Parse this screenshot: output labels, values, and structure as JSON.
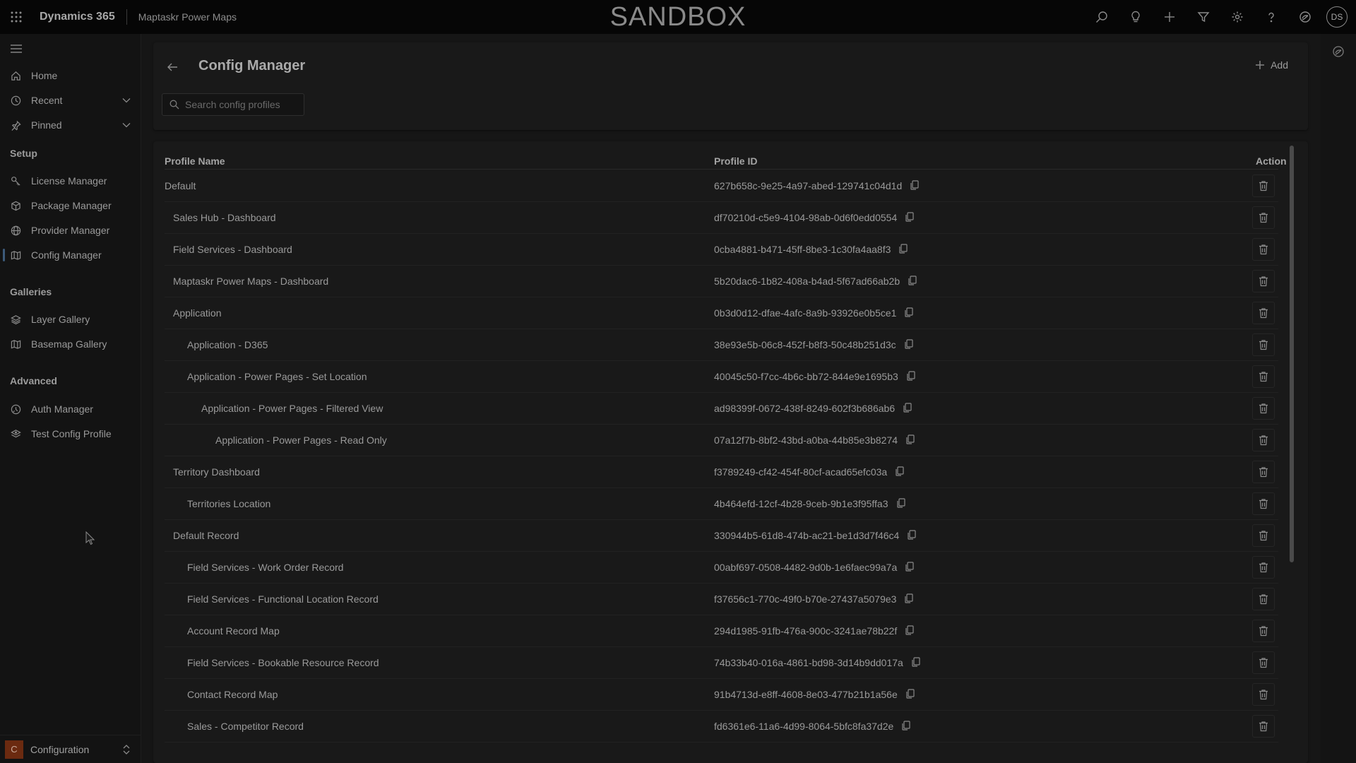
{
  "topbar": {
    "brand": "Dynamics 365",
    "app_name": "Maptaskr Power Maps",
    "environment_banner": "SANDBOX",
    "avatar_initials": "DS",
    "actions": [
      "search-icon",
      "lightbulb-icon",
      "plus-icon",
      "filter-icon",
      "gear-icon",
      "help-icon",
      "copilot-icon"
    ]
  },
  "sidebar": {
    "top_items": [
      {
        "label": "Home",
        "icon": "home-icon"
      },
      {
        "label": "Recent",
        "icon": "clock-icon",
        "expandable": true
      },
      {
        "label": "Pinned",
        "icon": "pin-icon",
        "expandable": true
      }
    ],
    "groups": [
      {
        "title": "Setup",
        "items": [
          {
            "label": "License Manager",
            "icon": "key-icon"
          },
          {
            "label": "Package Manager",
            "icon": "package-icon"
          },
          {
            "label": "Provider Manager",
            "icon": "globe-icon"
          },
          {
            "label": "Config Manager",
            "icon": "map-icon",
            "active": true
          }
        ]
      },
      {
        "title": "Galleries",
        "items": [
          {
            "label": "Layer Gallery",
            "icon": "layers-icon"
          },
          {
            "label": "Basemap Gallery",
            "icon": "map-icon"
          }
        ]
      },
      {
        "title": "Advanced",
        "items": [
          {
            "label": "Auth Manager",
            "icon": "auth-icon"
          },
          {
            "label": "Test Config Profile",
            "icon": "test-icon"
          }
        ]
      }
    ],
    "area": {
      "badge": "C",
      "label": "Configuration"
    }
  },
  "header": {
    "title": "Config Manager",
    "add_label": "Add",
    "search_placeholder": "Search config profiles"
  },
  "table": {
    "columns": {
      "name": "Profile Name",
      "id": "Profile ID",
      "action": "Action"
    },
    "rows": [
      {
        "name": "Default",
        "depth": 0,
        "id": "627b658c-9e25-4a97-abed-129741c04d1d"
      },
      {
        "name": "Sales Hub - Dashboard",
        "depth": 1,
        "id": "df70210d-c5e9-4104-98ab-0d6f0edd0554"
      },
      {
        "name": "Field Services - Dashboard",
        "depth": 1,
        "id": "0cba4881-b471-45ff-8be3-1c30fa4aa8f3"
      },
      {
        "name": "Maptaskr Power Maps - Dashboard",
        "depth": 1,
        "id": "5b20dac6-1b82-408a-b4ad-5f67ad66ab2b"
      },
      {
        "name": "Application",
        "depth": 1,
        "id": "0b3d0d12-dfae-4afc-8a9b-93926e0b5ce1"
      },
      {
        "name": "Application - D365",
        "depth": 2,
        "id": "38e93e5b-06c8-452f-b8f3-50c48b251d3c"
      },
      {
        "name": "Application - Power Pages - Set Location",
        "depth": 2,
        "id": "40045c50-f7cc-4b6c-bb72-844e9e1695b3"
      },
      {
        "name": "Application - Power Pages - Filtered View",
        "depth": 3,
        "id": "ad98399f-0672-438f-8249-602f3b686ab6"
      },
      {
        "name": "Application - Power Pages - Read Only",
        "depth": 4,
        "id": "07a12f7b-8bf2-43bd-a0ba-44b85e3b8274"
      },
      {
        "name": "Territory Dashboard",
        "depth": 1,
        "id": "f3789249-cf42-454f-80cf-acad65efc03a"
      },
      {
        "name": "Territories Location",
        "depth": 2,
        "id": "4b464efd-12cf-4b28-9ceb-9b1e3f95ffa3"
      },
      {
        "name": "Default Record",
        "depth": 1,
        "id": "330944b5-61d8-474b-ac21-be1d3d7f46c4"
      },
      {
        "name": "Field Services - Work Order Record",
        "depth": 2,
        "id": "00abf697-0508-4482-9d0b-1e6faec99a7a"
      },
      {
        "name": "Field Services - Functional Location Record",
        "depth": 2,
        "id": "f37656c1-770c-49f0-b70e-27437a5079e3"
      },
      {
        "name": "Account Record Map",
        "depth": 2,
        "id": "294d1985-91fb-476a-900c-3241ae78b22f"
      },
      {
        "name": "Field Services - Bookable Resource Record",
        "depth": 2,
        "id": "74b33b40-016a-4861-bd98-3d14b9dd017a"
      },
      {
        "name": "Contact Record Map",
        "depth": 2,
        "id": "91b4713d-e8ff-4608-8e03-477b21b1a56e"
      },
      {
        "name": "Sales - Competitor Record",
        "depth": 2,
        "id": "fd6361e6-11a6-4d99-8064-5bfc8fa37d2e"
      }
    ]
  },
  "colors": {
    "topbar_bg": "#060606",
    "page_bg": "#161616",
    "card_bg": "#191919",
    "text": "#9a9a9a",
    "active_indicator": "#3c5a7a",
    "area_badge": "#6b2a10"
  }
}
